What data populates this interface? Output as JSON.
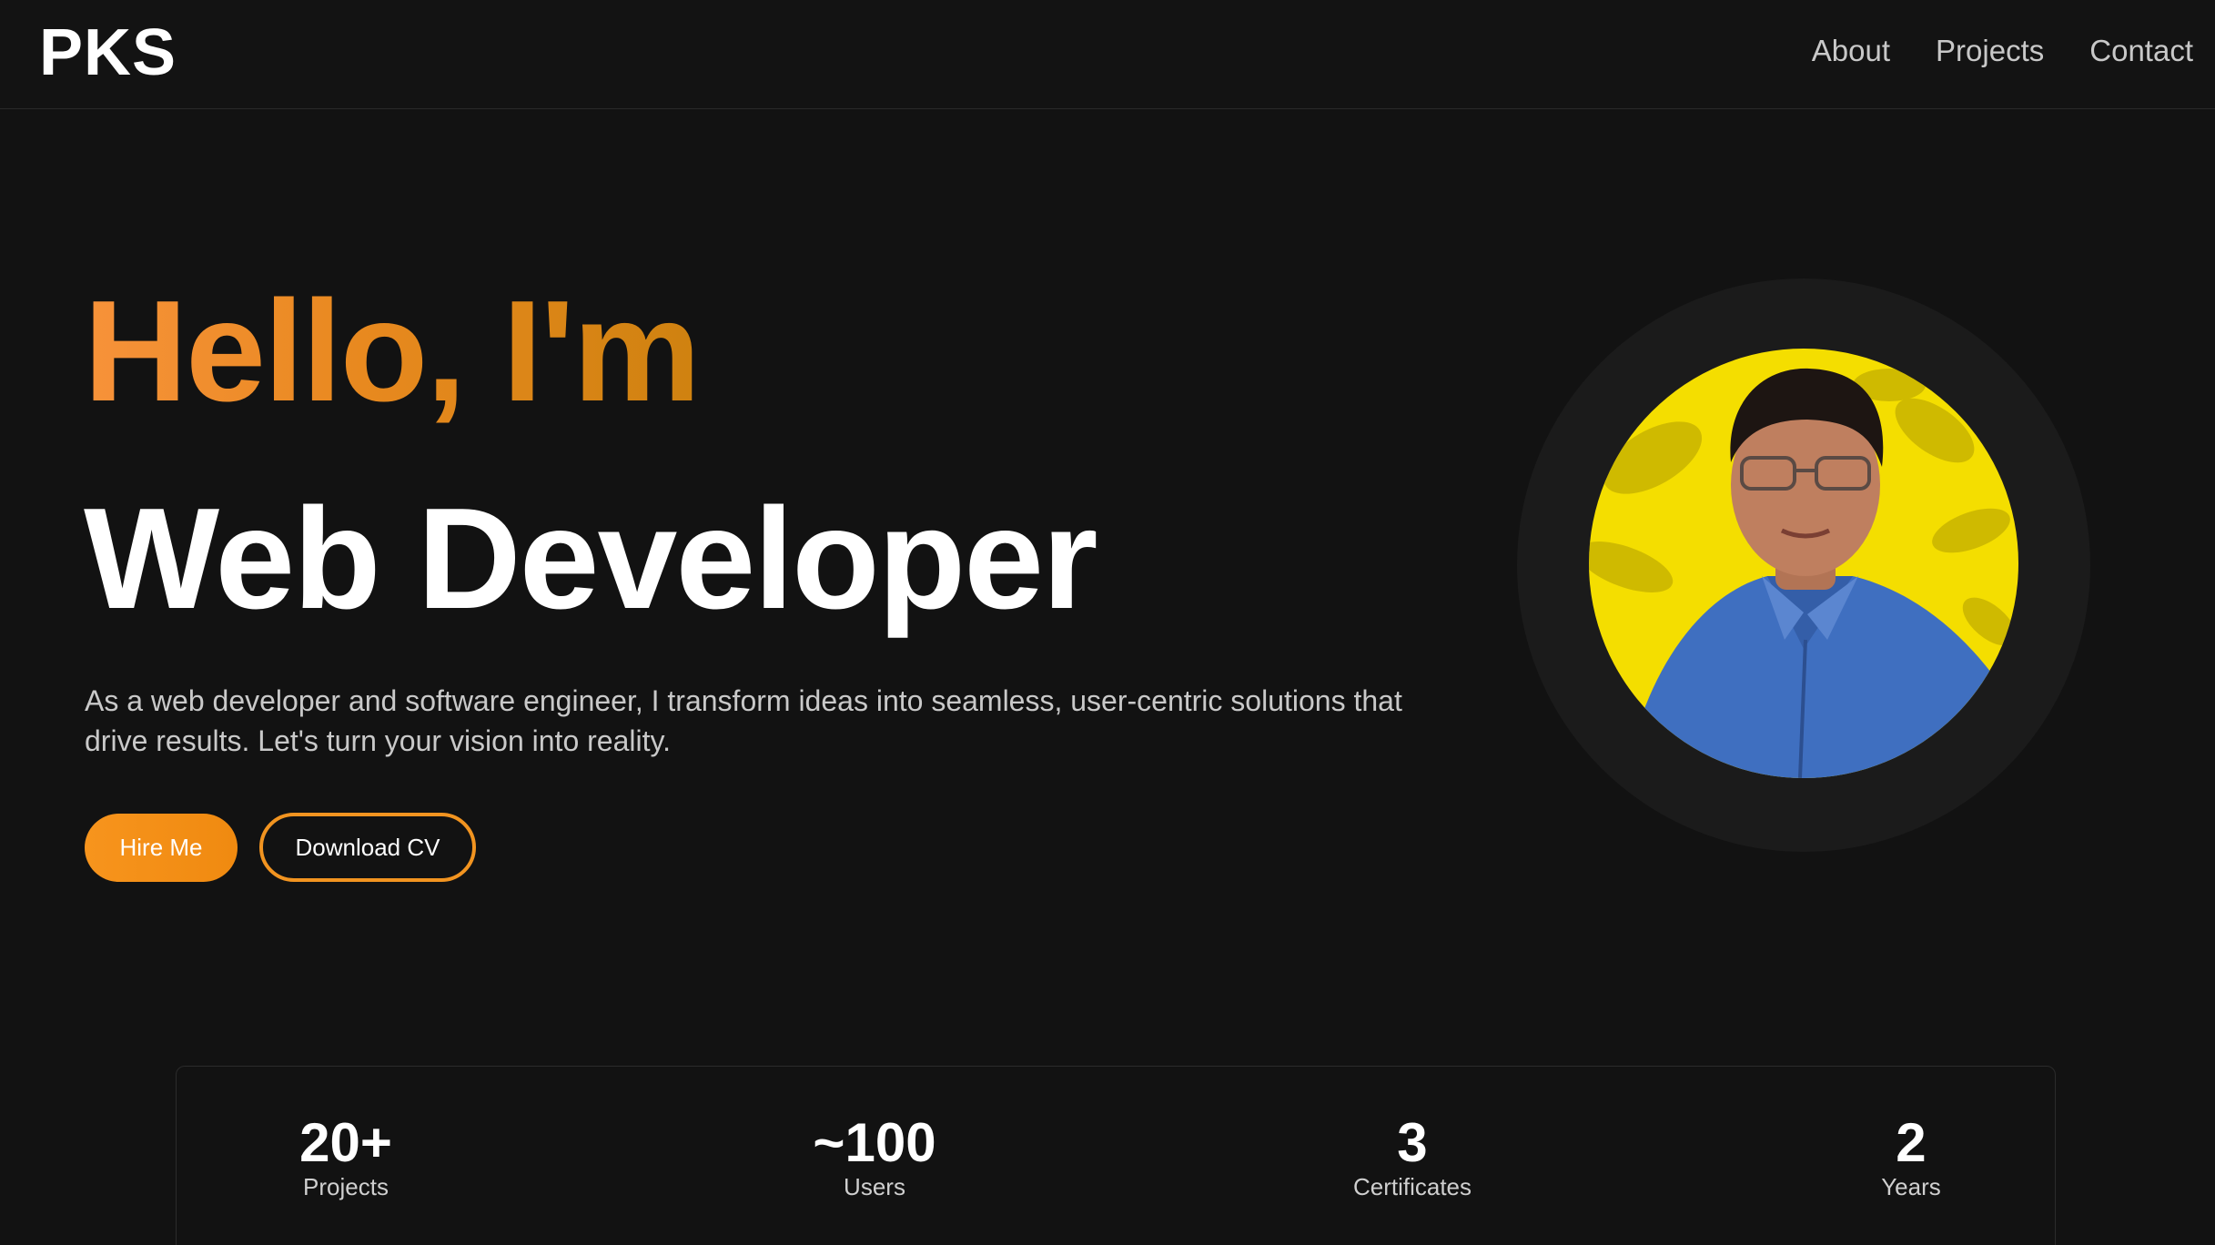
{
  "header": {
    "logo": "PKS",
    "nav": [
      {
        "label": "About"
      },
      {
        "label": "Projects"
      },
      {
        "label": "Contact"
      }
    ]
  },
  "hero": {
    "greeting": "Hello, I'm",
    "role": "Web Developer",
    "description": "As a web developer and software engineer, I transform ideas into seamless, user-centric solutions that drive results. Let's turn your vision into reality.",
    "hire_label": "Hire Me",
    "cv_label": "Download CV"
  },
  "stats": [
    {
      "value": "20+",
      "label": "Projects"
    },
    {
      "value": "~100",
      "label": "Users"
    },
    {
      "value": "3",
      "label": "Certificates"
    },
    {
      "value": "2",
      "label": "Years"
    }
  ],
  "colors": {
    "background": "#121212",
    "accent": "#f29420",
    "avatar_background": "#f4de00",
    "shirt": "#3f6fc0"
  }
}
